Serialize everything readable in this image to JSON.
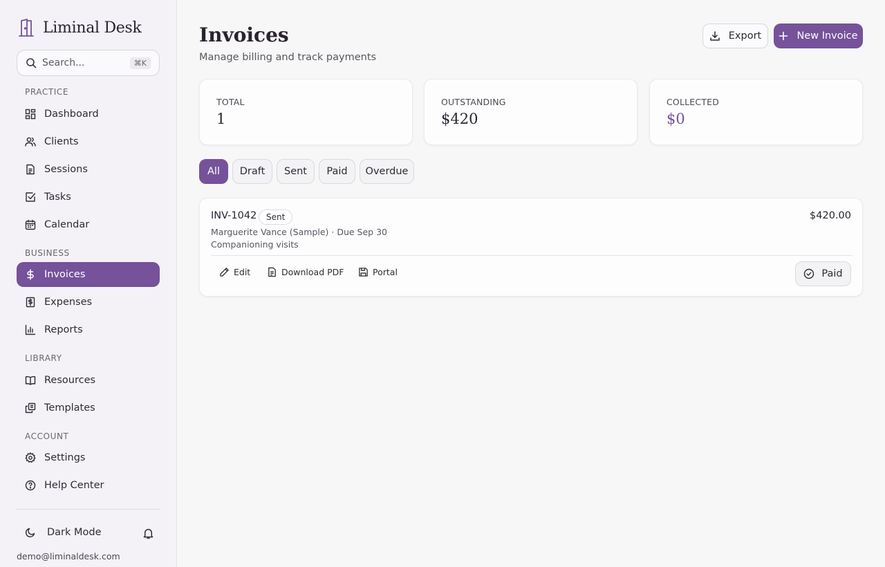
{
  "brand": {
    "name": "Liminal Desk"
  },
  "search": {
    "placeholder": "Search...",
    "shortcut": "⌘K"
  },
  "sidebar": {
    "sections": [
      {
        "label": "PRACTICE"
      },
      {
        "label": "BUSINESS"
      },
      {
        "label": "LIBRARY"
      },
      {
        "label": "ACCOUNT"
      }
    ],
    "items": [
      {
        "label": "Dashboard",
        "icon": "dashboard-icon"
      },
      {
        "label": "Clients",
        "icon": "users-icon"
      },
      {
        "label": "Sessions",
        "icon": "document-icon"
      },
      {
        "label": "Tasks",
        "icon": "checkbox-icon"
      },
      {
        "label": "Calendar",
        "icon": "calendar-icon"
      },
      {
        "label": "Invoices",
        "icon": "dollar-icon",
        "active": true
      },
      {
        "label": "Expenses",
        "icon": "receipt-icon"
      },
      {
        "label": "Reports",
        "icon": "bar-chart-icon"
      },
      {
        "label": "Resources",
        "icon": "book-icon"
      },
      {
        "label": "Templates",
        "icon": "copy-icon"
      },
      {
        "label": "Settings",
        "icon": "gear-icon"
      },
      {
        "label": "Help Center",
        "icon": "help-circle-icon"
      }
    ],
    "dark_mode_label": "Dark Mode",
    "user_email": "demo@liminaldesk.com"
  },
  "header": {
    "title": "Invoices",
    "subtitle": "Manage billing and track payments",
    "export_label": "Export",
    "new_invoice_label": "New Invoice"
  },
  "stats": [
    {
      "label": "TOTAL",
      "value": "1"
    },
    {
      "label": "OUTSTANDING",
      "value": "$420"
    },
    {
      "label": "COLLECTED",
      "value": "$0"
    }
  ],
  "filters": [
    {
      "label": "All",
      "active": true
    },
    {
      "label": "Draft"
    },
    {
      "label": "Sent"
    },
    {
      "label": "Paid"
    },
    {
      "label": "Overdue"
    }
  ],
  "invoices": [
    {
      "number": "INV-1042",
      "status": "Sent",
      "amount": "$420.00",
      "meta": "Marguerite Vance (Sample) · Due Sep 30",
      "description": "Companioning visits",
      "actions": {
        "edit": "Edit",
        "download": "Download PDF",
        "portal": "Portal"
      },
      "mark_paid_label": "Paid"
    }
  ],
  "colors": {
    "accent": "#75529a",
    "background": "#f8f7f7",
    "sidebar": "#f4f2f6"
  }
}
